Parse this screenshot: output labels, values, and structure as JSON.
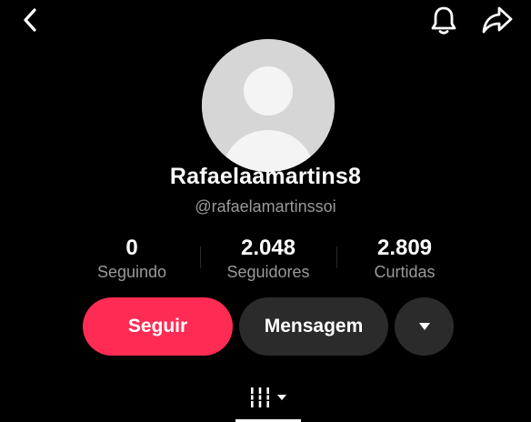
{
  "header": {
    "back_icon": "chevron-left-icon",
    "bell_icon": "bell-icon",
    "share_icon": "share-arrow-icon"
  },
  "profile": {
    "avatar_icon": "default-avatar-icon",
    "username": "Rafaelaamartins8",
    "handle": "@rafaelamartinssoi"
  },
  "stats": {
    "following": {
      "value": "0",
      "label": "Seguindo"
    },
    "followers": {
      "value": "2.048",
      "label": "Seguidores"
    },
    "likes": {
      "value": "2.809",
      "label": "Curtidas"
    }
  },
  "actions": {
    "follow_label": "Seguir",
    "message_label": "Mensagem",
    "more_icon": "caret-down-icon",
    "follow_color": "#fe2c55",
    "secondary_color": "#2b2b2b"
  },
  "tabs": {
    "grid_icon": "grid-columns-icon",
    "dropdown_icon": "caret-down-icon"
  },
  "theme": {
    "background": "#000000",
    "muted_text": "#9a9a9a"
  }
}
